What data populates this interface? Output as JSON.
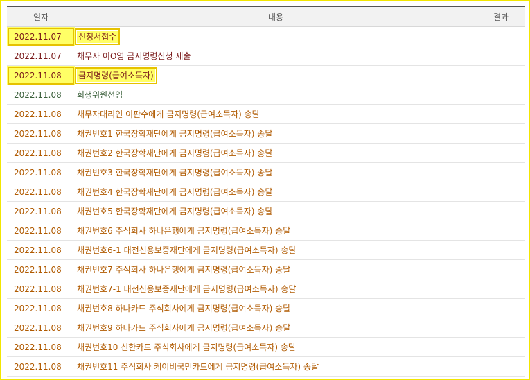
{
  "header": {
    "date": "일자",
    "content": "내용",
    "result": "결과"
  },
  "rows": [
    {
      "date": "2022.11.07",
      "content": "신청서접수",
      "result": "",
      "highlight": true,
      "tone": "red"
    },
    {
      "date": "2022.11.07",
      "content": "채무자 이O영 금지명령신청 제출",
      "result": "",
      "highlight": false,
      "tone": "red"
    },
    {
      "date": "2022.11.08",
      "content": "금지명령(급여소득자)",
      "result": "",
      "highlight": true,
      "tone": "red"
    },
    {
      "date": "2022.11.08",
      "content": "회생위원선임",
      "result": "",
      "highlight": false,
      "tone": "green"
    },
    {
      "date": "2022.11.08",
      "content": "채무자대리인 이판수에게 금지명령(급여소득자) 송달",
      "result": "",
      "highlight": false,
      "tone": "orange"
    },
    {
      "date": "2022.11.08",
      "content": "채권번호1 한국장학재단에게 금지명령(급여소득자) 송달",
      "result": "",
      "highlight": false,
      "tone": "orange"
    },
    {
      "date": "2022.11.08",
      "content": "채권번호2 한국장학재단에게 금지명령(급여소득자) 송달",
      "result": "",
      "highlight": false,
      "tone": "orange"
    },
    {
      "date": "2022.11.08",
      "content": "채권번호3 한국장학재단에게 금지명령(급여소득자) 송달",
      "result": "",
      "highlight": false,
      "tone": "orange"
    },
    {
      "date": "2022.11.08",
      "content": "채권번호4 한국장학재단에게 금지명령(급여소득자) 송달",
      "result": "",
      "highlight": false,
      "tone": "orange"
    },
    {
      "date": "2022.11.08",
      "content": "채권번호5 한국장학재단에게 금지명령(급여소득자) 송달",
      "result": "",
      "highlight": false,
      "tone": "orange"
    },
    {
      "date": "2022.11.08",
      "content": "채권번호6 주식회사 하나은행에게 금지명령(급여소득자) 송달",
      "result": "",
      "highlight": false,
      "tone": "orange"
    },
    {
      "date": "2022.11.08",
      "content": "채권번호6-1 대전신용보증재단에게 금지명령(급여소득자) 송달",
      "result": "",
      "highlight": false,
      "tone": "orange"
    },
    {
      "date": "2022.11.08",
      "content": "채권번호7 주식회사 하나은행에게 금지명령(급여소득자) 송달",
      "result": "",
      "highlight": false,
      "tone": "orange"
    },
    {
      "date": "2022.11.08",
      "content": "채권번호7-1 대전신용보증재단에게 금지명령(급여소득자) 송달",
      "result": "",
      "highlight": false,
      "tone": "orange"
    },
    {
      "date": "2022.11.08",
      "content": "채권번호8 하나카드 주식회사에게 금지명령(급여소득자) 송달",
      "result": "",
      "highlight": false,
      "tone": "orange"
    },
    {
      "date": "2022.11.08",
      "content": "채권번호9 하나카드 주식회사에게 금지명령(급여소득자) 송달",
      "result": "",
      "highlight": false,
      "tone": "orange"
    },
    {
      "date": "2022.11.08",
      "content": "채권번호10 신한카드 주식회사에게 금지명령(급여소득자) 송달",
      "result": "",
      "highlight": false,
      "tone": "orange"
    },
    {
      "date": "2022.11.08",
      "content": "채권번호11 주식회사 케이비국민카드에게 금지명령(급여소득자) 송달",
      "result": "",
      "highlight": false,
      "tone": "orange"
    }
  ],
  "colors": {
    "frame": "#f2e600",
    "highlight": "#ffff66",
    "red": "#7a1a1a",
    "green": "#3a5f3a",
    "orange": "#b05a00"
  }
}
